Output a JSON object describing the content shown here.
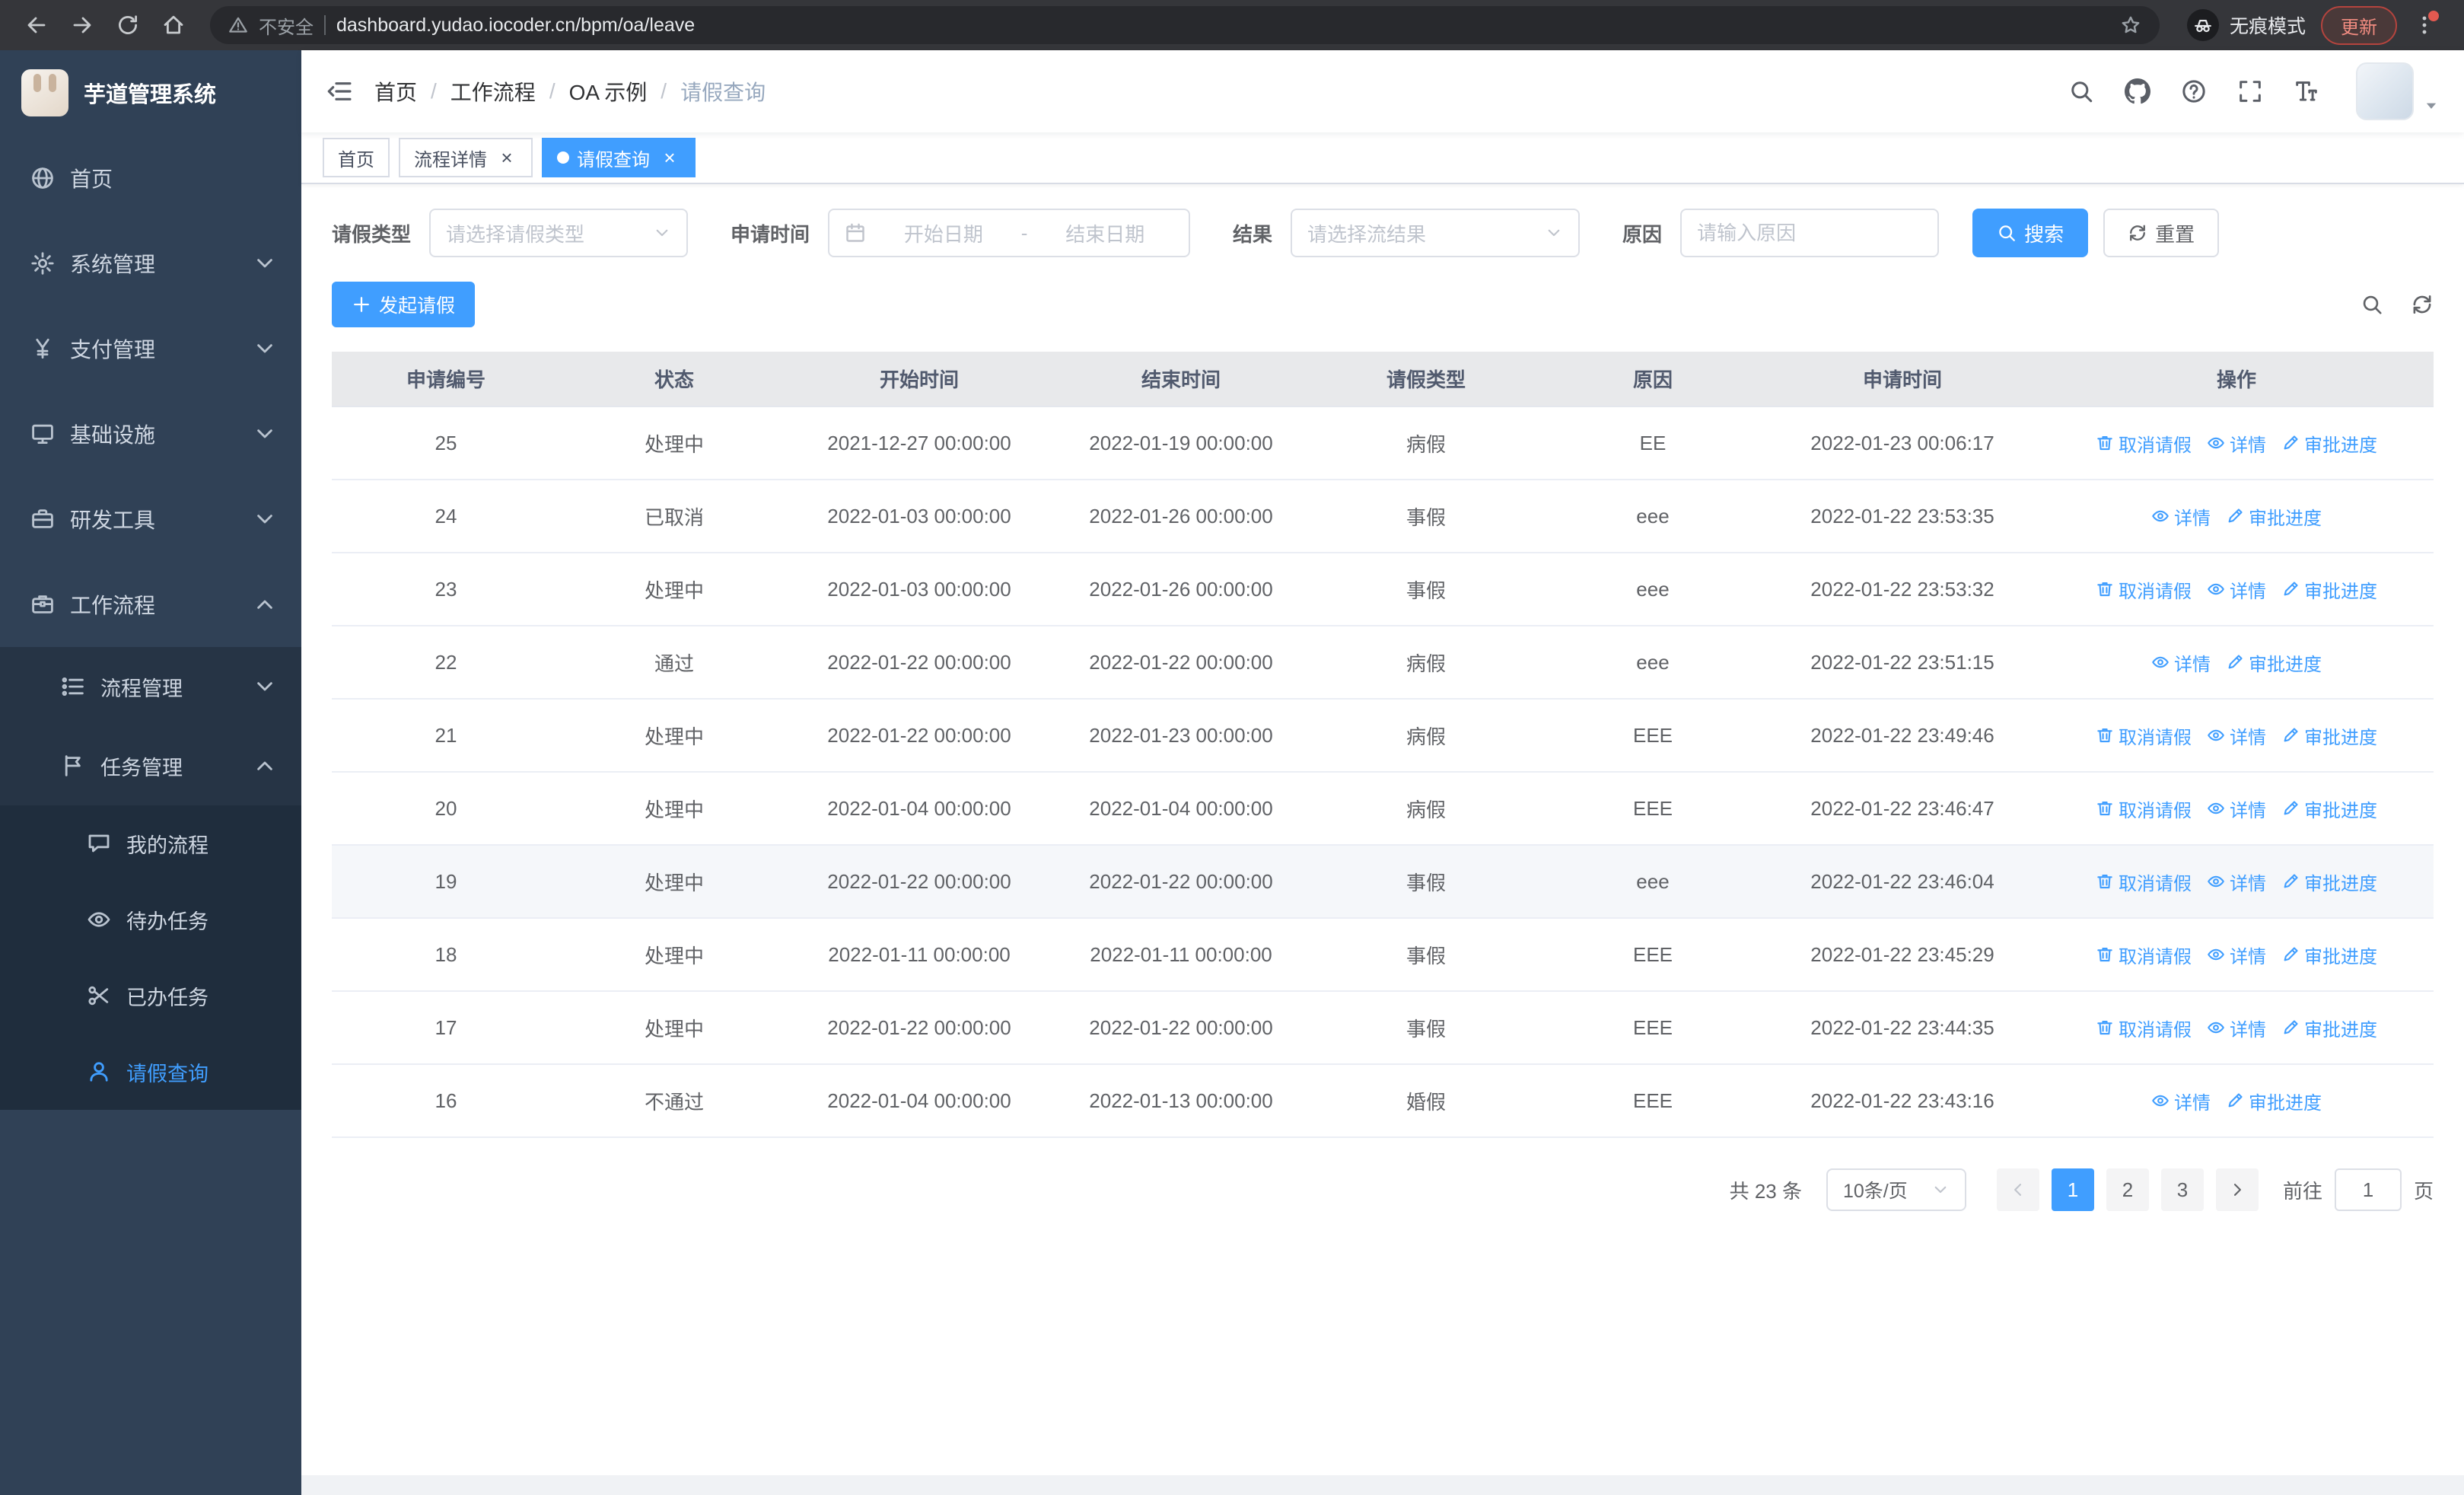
{
  "colors": {
    "primary": "#409eff"
  },
  "browser": {
    "security_label": "不安全",
    "url": "dashboard.yudao.iocoder.cn/bpm/oa/leave",
    "incognito_label": "无痕模式",
    "update_label": "更新"
  },
  "sidebar": {
    "logo_title": "芋道管理系统",
    "menu": [
      {
        "label": "首页",
        "icon": "dashboard-icon",
        "level": 1
      },
      {
        "label": "系统管理",
        "icon": "gear-icon",
        "level": 1,
        "arrow": "down"
      },
      {
        "label": "支付管理",
        "icon": "yen-icon",
        "level": 1,
        "arrow": "down"
      },
      {
        "label": "基础设施",
        "icon": "infrastructure-icon",
        "level": 1,
        "arrow": "down"
      },
      {
        "label": "研发工具",
        "icon": "tools-icon",
        "level": 1,
        "arrow": "down"
      },
      {
        "label": "工作流程",
        "icon": "workflow-icon",
        "level": 1,
        "arrow": "up"
      },
      {
        "label": "流程管理",
        "icon": "process-icon",
        "level": 2,
        "arrow": "down"
      },
      {
        "label": "任务管理",
        "icon": "task-icon",
        "level": 2,
        "arrow": "up"
      },
      {
        "label": "我的流程",
        "icon": "chat-icon",
        "level": 3
      },
      {
        "label": "待办任务",
        "icon": "eye-icon",
        "level": 3
      },
      {
        "label": "已办任务",
        "icon": "done-icon",
        "level": 3
      },
      {
        "label": "请假查询",
        "icon": "user-icon",
        "level": 3,
        "active": true
      }
    ]
  },
  "header": {
    "breadcrumb": [
      "首页",
      "工作流程",
      "OA 示例",
      "请假查询"
    ]
  },
  "tabs": [
    {
      "label": "首页",
      "closable": false,
      "active": false
    },
    {
      "label": "流程详情",
      "closable": true,
      "active": false
    },
    {
      "label": "请假查询",
      "closable": true,
      "active": true
    }
  ],
  "filters": {
    "leave_type_label": "请假类型",
    "leave_type_placeholder": "请选择请假类型",
    "apply_time_label": "申请时间",
    "start_date_placeholder": "开始日期",
    "range_separator": "-",
    "end_date_placeholder": "结束日期",
    "result_label": "结果",
    "result_placeholder": "请选择流结果",
    "reason_label": "原因",
    "reason_placeholder": "请输入原因",
    "search_button": "搜索",
    "reset_button": "重置"
  },
  "toolbar": {
    "create_button": "发起请假"
  },
  "table": {
    "headers": [
      "申请编号",
      "状态",
      "开始时间",
      "结束时间",
      "请假类型",
      "原因",
      "申请时间",
      "操作"
    ],
    "action_labels": {
      "cancel": "取消请假",
      "detail": "详情",
      "progress": "审批进度"
    },
    "rows": [
      {
        "no": "25",
        "status": "处理中",
        "start_time": "2021-12-27 00:00:00",
        "end_time": "2022-01-19 00:00:00",
        "type": "病假",
        "reason": "EE",
        "apply_time": "2022-01-23 00:06:17",
        "actions": [
          "cancel",
          "detail",
          "progress"
        ]
      },
      {
        "no": "24",
        "status": "已取消",
        "start_time": "2022-01-03 00:00:00",
        "end_time": "2022-01-26 00:00:00",
        "type": "事假",
        "reason": "eee",
        "apply_time": "2022-01-22 23:53:35",
        "actions": [
          "detail",
          "progress"
        ]
      },
      {
        "no": "23",
        "status": "处理中",
        "start_time": "2022-01-03 00:00:00",
        "end_time": "2022-01-26 00:00:00",
        "type": "事假",
        "reason": "eee",
        "apply_time": "2022-01-22 23:53:32",
        "actions": [
          "cancel",
          "detail",
          "progress"
        ]
      },
      {
        "no": "22",
        "status": "通过",
        "start_time": "2022-01-22 00:00:00",
        "end_time": "2022-01-22 00:00:00",
        "type": "病假",
        "reason": "eee",
        "apply_time": "2022-01-22 23:51:15",
        "actions": [
          "detail",
          "progress"
        ]
      },
      {
        "no": "21",
        "status": "处理中",
        "start_time": "2022-01-22 00:00:00",
        "end_time": "2022-01-23 00:00:00",
        "type": "病假",
        "reason": "EEE",
        "apply_time": "2022-01-22 23:49:46",
        "actions": [
          "cancel",
          "detail",
          "progress"
        ]
      },
      {
        "no": "20",
        "status": "处理中",
        "start_time": "2022-01-04 00:00:00",
        "end_time": "2022-01-04 00:00:00",
        "type": "病假",
        "reason": "EEE",
        "apply_time": "2022-01-22 23:46:47",
        "actions": [
          "cancel",
          "detail",
          "progress"
        ]
      },
      {
        "no": "19",
        "status": "处理中",
        "start_time": "2022-01-22 00:00:00",
        "end_time": "2022-01-22 00:00:00",
        "type": "事假",
        "reason": "eee",
        "apply_time": "2022-01-22 23:46:04",
        "actions": [
          "cancel",
          "detail",
          "progress"
        ],
        "highlighted": true
      },
      {
        "no": "18",
        "status": "处理中",
        "start_time": "2022-01-11 00:00:00",
        "end_time": "2022-01-11 00:00:00",
        "type": "事假",
        "reason": "EEE",
        "apply_time": "2022-01-22 23:45:29",
        "actions": [
          "cancel",
          "detail",
          "progress"
        ]
      },
      {
        "no": "17",
        "status": "处理中",
        "start_time": "2022-01-22 00:00:00",
        "end_time": "2022-01-22 00:00:00",
        "type": "事假",
        "reason": "EEE",
        "apply_time": "2022-01-22 23:44:35",
        "actions": [
          "cancel",
          "detail",
          "progress"
        ]
      },
      {
        "no": "16",
        "status": "不通过",
        "start_time": "2022-01-04 00:00:00",
        "end_time": "2022-01-13 00:00:00",
        "type": "婚假",
        "reason": "EEE",
        "apply_time": "2022-01-22 23:43:16",
        "actions": [
          "detail",
          "progress"
        ]
      }
    ]
  },
  "pagination": {
    "total_text": "共 23 条",
    "page_size": "10条/页",
    "pages": [
      "1",
      "2",
      "3"
    ],
    "active_page": "1",
    "goto_label": "前往",
    "goto_value": "1",
    "goto_suffix": "页"
  },
  "icons": {
    "search-icon": "magnifier",
    "github-icon": "github-mark",
    "help-icon": "question-circle",
    "fullscreen-icon": "expand-corners",
    "fontsize-icon": "text-size",
    "delete-icon": "trash",
    "view-icon": "eye",
    "edit-icon": "pen",
    "calendar-icon": "calendar",
    "refresh-icon": "circular-arrows",
    "plus-icon": "plus",
    "incognito-icon": "spy-hat-glasses",
    "warning-icon": "triangle-exclamation",
    "star-icon": "bookmark-star"
  }
}
